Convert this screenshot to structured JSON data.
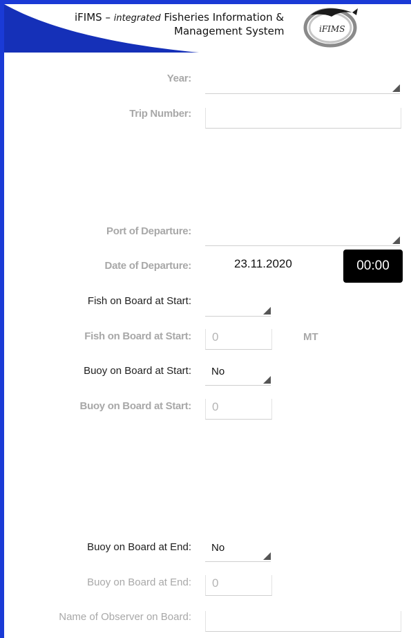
{
  "header": {
    "title_prefix": "iFIMS – ",
    "title_em": "integrated",
    "title_rest": " Fisheries Information &",
    "title_line2": "Management System",
    "logo_text": "iFIMS"
  },
  "colors": {
    "frame": "#1a3ad6",
    "swoosh": "#1530b8",
    "time_bg": "#000000"
  },
  "form": {
    "year": {
      "label": "Year:",
      "value": ""
    },
    "trip_number": {
      "label": "Trip Number:",
      "value": ""
    },
    "port_of_departure": {
      "label": "Port of Departure:",
      "value": ""
    },
    "date_of_departure": {
      "label": "Date of Departure:",
      "date": "23.11.2020",
      "time": "00:00"
    },
    "fish_on_board_start_select": {
      "label": "Fish on Board at Start:",
      "value": ""
    },
    "fish_on_board_start_qty": {
      "label": "Fish on Board at Start:",
      "placeholder": "0",
      "unit": "MT"
    },
    "buoy_on_board_start_select": {
      "label": "Buoy on Board at Start:",
      "value": "No"
    },
    "buoy_on_board_start_qty": {
      "label": "Buoy on Board at Start:",
      "placeholder": "0"
    },
    "buoy_on_board_end_select": {
      "label": "Buoy on Board at End:",
      "value": "No"
    },
    "buoy_on_board_end_qty": {
      "label": "Buoy on Board at End:",
      "placeholder": "0"
    },
    "observer_name": {
      "label": "Name of Observer on Board:",
      "value": ""
    }
  }
}
